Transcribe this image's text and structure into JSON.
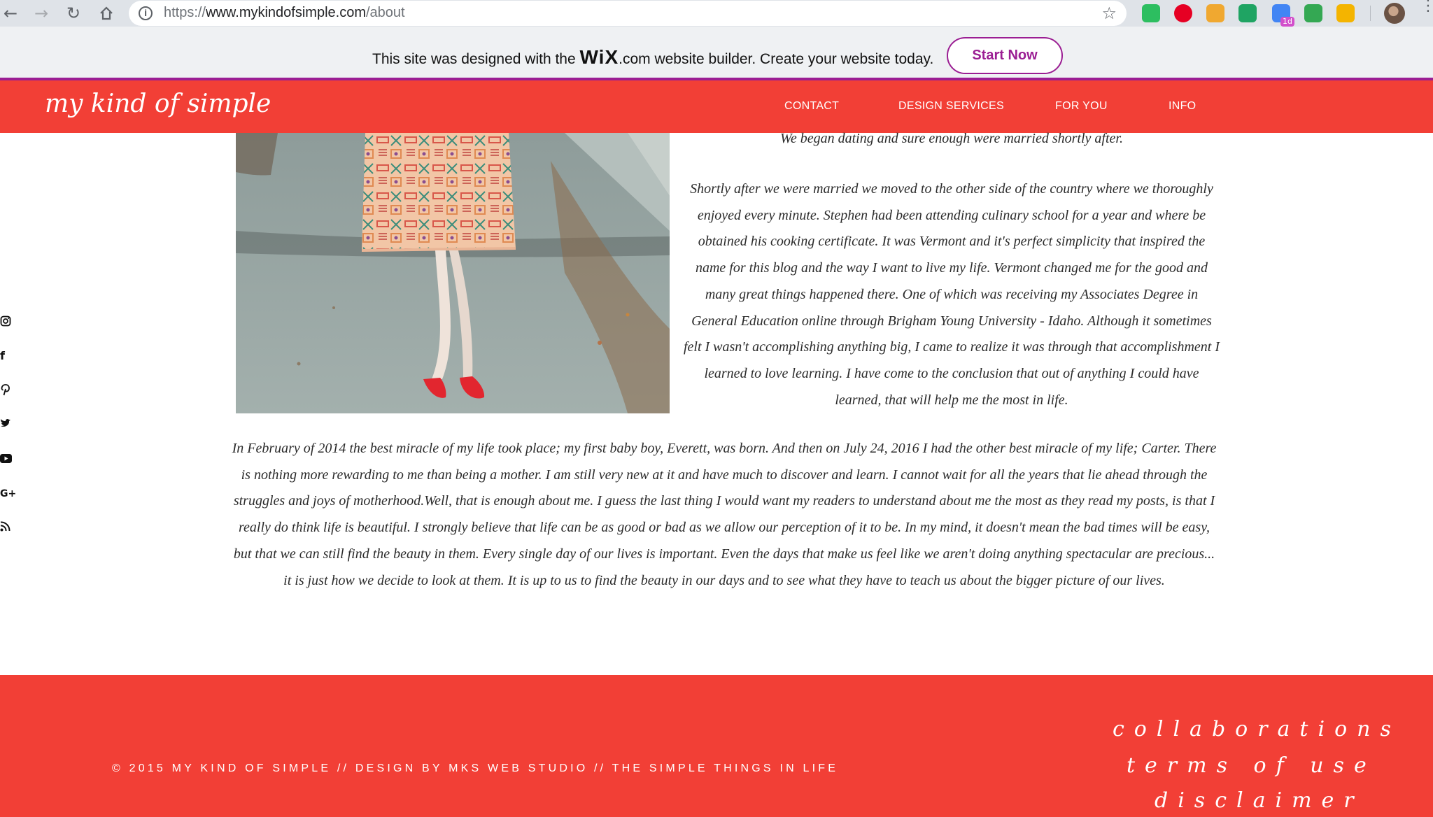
{
  "browser": {
    "url_scheme": "https://",
    "url_host": "www.mykindofsimple.com",
    "url_path": "/about",
    "extensions": [
      {
        "icon": "evernote-icon",
        "color": "#2dbe60"
      },
      {
        "icon": "pinterest-icon",
        "color": "#e60023"
      },
      {
        "icon": "amazon-assistant-icon",
        "color": "#f0a830"
      },
      {
        "icon": "google-drive-icon",
        "color": "#1fa463"
      },
      {
        "icon": "calendar-icon",
        "color": "#4285f4",
        "badge": "1d"
      },
      {
        "icon": "checkmark-icon",
        "color": "#34a853"
      },
      {
        "icon": "color-picker-icon",
        "color": "#f4b400"
      }
    ]
  },
  "wix_banner": {
    "text_before": "This site was designed with the ",
    "logo_wix": "WiX",
    "text_after": ".com website builder. Create your website today.",
    "button_label": "Start Now"
  },
  "site": {
    "logo": "my kind of simple",
    "nav": [
      "CONTACT",
      "DESIGN SERVICES",
      "FOR YOU",
      "INFO"
    ],
    "social_icons": [
      "instagram-icon",
      "facebook-icon",
      "pinterest-icon",
      "twitter-icon",
      "youtube-icon",
      "google-plus-icon",
      "rss-icon"
    ]
  },
  "content": {
    "paragraph_1": "We began dating and sure enough were married shortly after.",
    "paragraph_2": "Shortly after we were married we moved to the other side of the country where we thoroughly enjoyed every minute. Stephen had been attending culinary school for a year and where be obtained his cooking certificate. It was Vermont and it's perfect simplicity that inspired the name for this blog and the way I want to live my life. Vermont changed me for the good and many great things happened there. One of which was receiving my Associates Degree in General Education online through Brigham Young University - Idaho. Although it sometimes felt I wasn't accomplishing anything big, I came to realize it was through that accomplishment I learned to love learning. I have come to the conclusion that out of anything I could have learned, that will help me the most in life.",
    "paragraph_3": "In February of 2014 the best miracle of my life took place; my first baby boy, Everett, was born. And then on July 24, 2016 I had the other best miracle of my life; Carter. There is nothing more rewarding to me than being a mother. I am still very new at it and have much to discover and learn. I cannot wait for all the years that lie ahead through the struggles and joys of motherhood.Well, that is enough about me. I guess the last thing I would want my readers to understand about me the most as they read my posts, is that I really do think life is beautiful. I strongly believe that life can be as good or bad as we allow our perception of it to be. In my mind, it doesn't mean the bad times will be easy, but that we can still find the beauty in them. Every single day of our lives is important. Even the days that make us feel like we aren't doing anything spectacular are precious... it is just how we decide to look at them. It is up to us to find the beauty in our days and to see what they have to teach us about the bigger picture of our lives."
  },
  "footer": {
    "copyright": "© 2015 MY KIND OF SIMPLE // DESIGN BY MKS WEB STUDIO // THE SIMPLE THINGS IN LIFE",
    "links": [
      "collaborations",
      "terms of use",
      "disclaimer"
    ]
  },
  "colors": {
    "brand_red": "#f23f36",
    "wix_purple": "#9b1e93"
  }
}
